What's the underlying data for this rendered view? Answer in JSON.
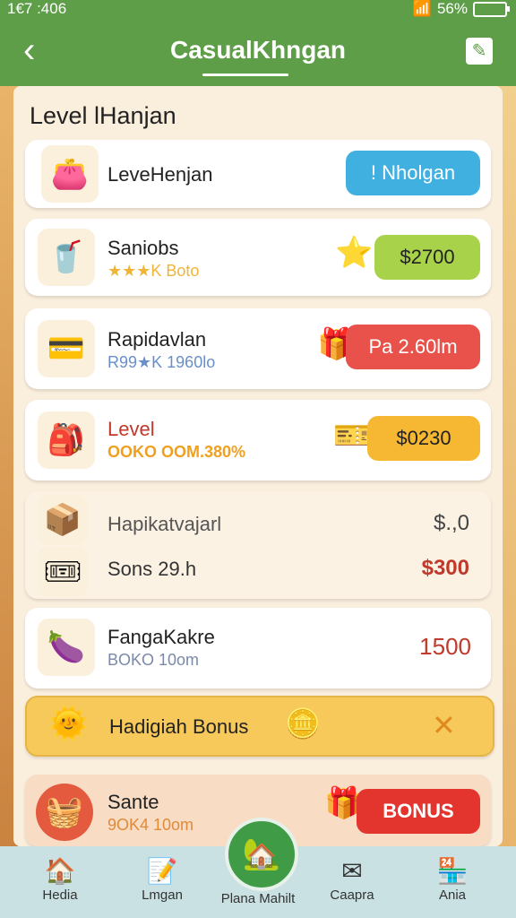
{
  "status_bar": {
    "time": "1€7 :406",
    "battery": "56%"
  },
  "header": {
    "title": "CasualKhngan"
  },
  "panel": {
    "title": "Level   lHanjan"
  },
  "rows": [
    {
      "name": "LeveHenjan",
      "sub": "",
      "action": "! Nholgan",
      "pill_color": "#3fb0e0",
      "pill_text_color": "#ffffff"
    },
    {
      "name": "Saniobs",
      "sub": "★★★K Boto",
      "sub_color": "#f0b437",
      "action": "$2700",
      "pill_color": "#a8d24a",
      "pill_text_color": "#222222"
    },
    {
      "name": "Rapidavlan",
      "sub": "R99★K 1960lo",
      "sub_color": "#6a8fc8",
      "action": "Pa 2.60lm",
      "pill_color": "#e8524a",
      "pill_text_color": "#ffffff"
    },
    {
      "name": "Level",
      "name_color": "#c0392b",
      "sub": "OOKO OOM.380%",
      "sub_color": "#f0a020",
      "action": "$0230",
      "pill_color": "#f6b733",
      "pill_text_color": "#222222"
    }
  ],
  "group": {
    "line1": "Hapikatvajarl",
    "price1": "$.,0",
    "line2": "Sons 29.h",
    "price2": "$300"
  },
  "item5": {
    "name": "FangaKakre",
    "sub": "BOKO 10om",
    "price": "1500"
  },
  "bonus": {
    "label": "Hadigiah Bonus"
  },
  "last": {
    "name": "Sante",
    "sub": "9OK4 10om",
    "action": "BONUS"
  },
  "nav": {
    "items": [
      {
        "label": "Hedia"
      },
      {
        "label": "Lmgan"
      },
      {
        "label": "Plana Mahilt"
      },
      {
        "label": "Caapra"
      },
      {
        "label": "Ania"
      }
    ]
  },
  "colors": {
    "header": "#5f9e49",
    "panel": "#faeedd",
    "nav": "#c9e1e2"
  }
}
